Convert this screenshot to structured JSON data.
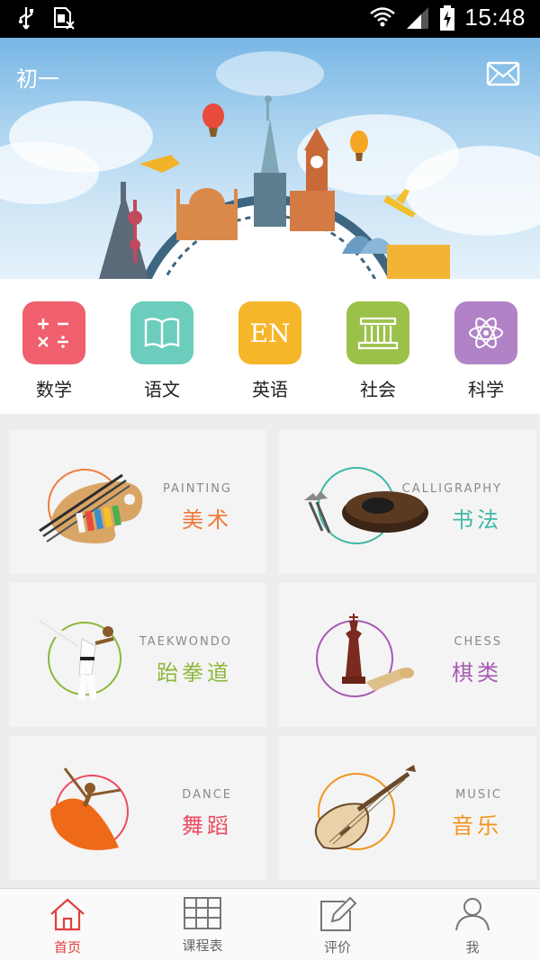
{
  "status_bar": {
    "time": "15:48"
  },
  "header": {
    "grade": "初一"
  },
  "subjects": [
    {
      "label": "数学",
      "color": "#f0606e",
      "icon": "math-icon"
    },
    {
      "label": "语文",
      "color": "#6ccdbd",
      "icon": "book-icon"
    },
    {
      "label": "英语",
      "color": "#f5b62a",
      "icon_text": "EN",
      "icon": "english-icon"
    },
    {
      "label": "社会",
      "color": "#9bc14a",
      "icon": "building-icon"
    },
    {
      "label": "科学",
      "color": "#b183c6",
      "icon": "atom-icon"
    }
  ],
  "courses": [
    {
      "en": "PAINTING",
      "cn": "美术",
      "color": "#f07a3c",
      "icon": "palette-icon"
    },
    {
      "en": "CALLIGRAPHY",
      "cn": "书法",
      "color": "#3fb8a6",
      "icon": "inkstone-icon"
    },
    {
      "en": "TAEKWONDO",
      "cn": "跆拳道",
      "color": "#8cb83a",
      "icon": "taekwondo-icon"
    },
    {
      "en": "CHESS",
      "cn": "棋类",
      "color": "#a65ab2",
      "icon": "chess-icon"
    },
    {
      "en": "DANCE",
      "cn": "舞蹈",
      "color": "#ec4a60",
      "icon": "dancer-icon"
    },
    {
      "en": "MUSIC",
      "cn": "音乐",
      "color": "#f2941c",
      "icon": "pipa-icon"
    }
  ],
  "tabs": [
    {
      "label": "首页",
      "icon": "home-icon",
      "active": true
    },
    {
      "label": "课程表",
      "icon": "grid-icon",
      "active": false
    },
    {
      "label": "评价",
      "icon": "edit-icon",
      "active": false
    },
    {
      "label": "我",
      "icon": "user-icon",
      "active": false
    }
  ],
  "accent": "#e0403c"
}
